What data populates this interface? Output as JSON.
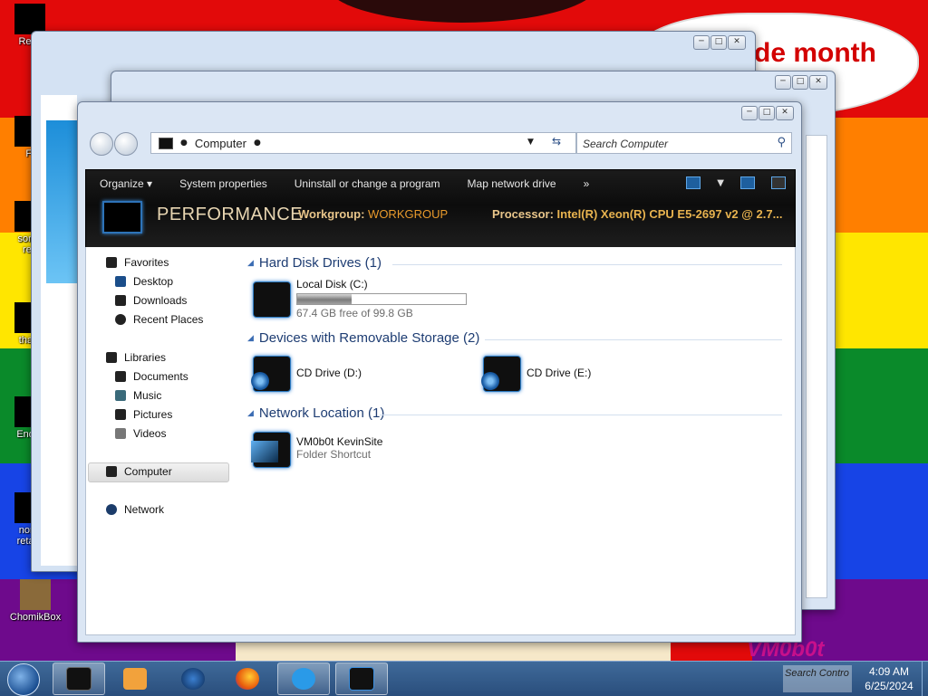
{
  "wallpaper": {
    "bubble_text": "de month",
    "brand_text": "VM0b0t"
  },
  "desktop_icons": [
    {
      "label": "Recy"
    },
    {
      "label": "Fi"
    },
    {
      "label": "some"
    },
    {
      "label": "ren"
    },
    {
      "label": "thatb"
    },
    {
      "label": "Ender"
    },
    {
      "label": "none"
    },
    {
      "label": "retard"
    },
    {
      "label": "ChomikBox"
    }
  ],
  "window": {
    "address": "Computer",
    "search_placeholder": "Search Computer",
    "caption": {
      "minimize": "─",
      "maximize": "□",
      "close": "✕"
    }
  },
  "toolbar": {
    "organize": "Organize",
    "system_properties": "System properties",
    "uninstall": "Uninstall or change a program",
    "map_drive": "Map network drive",
    "more": "»"
  },
  "details": {
    "computer_name": "PERFORMANCE",
    "workgroup_label": "Workgroup:",
    "workgroup_value": "WORKGROUP",
    "processor_label": "Processor:",
    "processor_value": "Intel(R) Xeon(R) CPU E5-2697 v2 @ 2.7..."
  },
  "nav": {
    "favorites": "Favorites",
    "desktop": "Desktop",
    "downloads": "Downloads",
    "recent": "Recent Places",
    "libraries": "Libraries",
    "documents": "Documents",
    "music": "Music",
    "pictures": "Pictures",
    "videos": "Videos",
    "computer": "Computer",
    "network": "Network"
  },
  "groups": {
    "hdd": "Hard Disk Drives (1)",
    "removable": "Devices with Removable Storage (2)",
    "network": "Network Location (1)"
  },
  "drives": {
    "c_name": "Local Disk (C:)",
    "c_free": "67.4 GB free of 99.8 GB",
    "c_used_fraction": 0.325,
    "d_name": "CD Drive (D:)",
    "e_name": "CD Drive (E:)",
    "net_name": "VM0b0t KevinSite",
    "net_type": "Folder Shortcut"
  },
  "taskbar": {
    "tray_text": "Search Contro",
    "time": "4:09 AM",
    "date": "6/25/2024"
  }
}
